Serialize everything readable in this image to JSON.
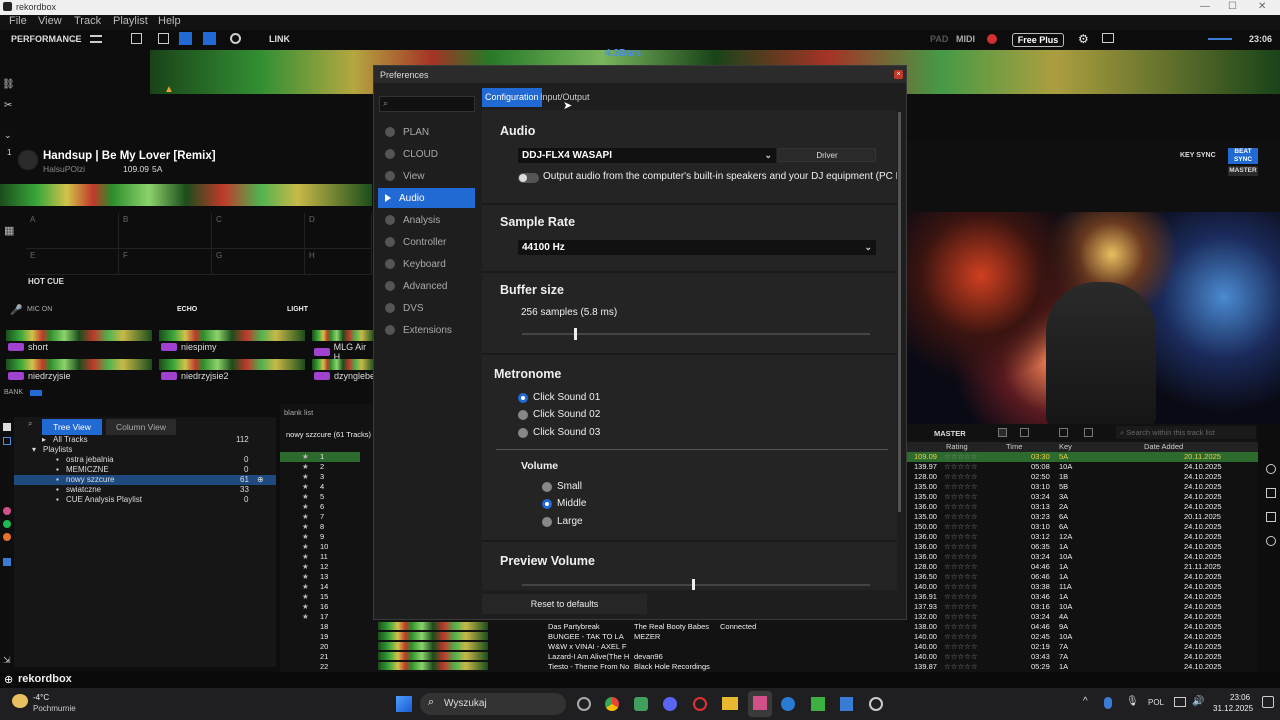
{
  "window": {
    "title": "rekordbox"
  },
  "menu": [
    "File",
    "View",
    "Track",
    "Playlist",
    "Help"
  ],
  "toolbar": {
    "mode": "PERFORMANCE",
    "link": "LINK",
    "pad": "PAD",
    "midi": "MIDI",
    "free_plus": "Free Plus",
    "clock": "23:06",
    "bars": "4.3Bars"
  },
  "deck": {
    "title": "Handsup | Be My Lover [Remix]",
    "artist": "HalsuPOlzi",
    "bpm": "109.09",
    "key": "5A",
    "hot_cue": "HOT CUE",
    "pads": [
      "A",
      "B",
      "C",
      "D",
      "E",
      "F",
      "G",
      "H"
    ],
    "key_sync": "KEY SYNC",
    "beat_sync": "BEAT SYNC",
    "master": "MASTER"
  },
  "fx": {
    "mic": "MIC ON",
    "echo": "ECHO",
    "light": "LIGHT"
  },
  "samplers": [
    {
      "name": "short"
    },
    {
      "name": "niespimy"
    },
    {
      "name": "MLG Air H"
    },
    {
      "name": "niedrzyjsie"
    },
    {
      "name": "niedrzyjsie2"
    },
    {
      "name": "dzynglebe"
    }
  ],
  "bank": "BANK",
  "browser": {
    "tree_view": "Tree View",
    "column_view": "Column View",
    "all_tracks": "All Tracks",
    "all_count": "112",
    "playlists": "Playlists",
    "items": [
      {
        "name": "ostra jebalnia",
        "count": "0"
      },
      {
        "name": "MEMICZNE",
        "count": "0"
      },
      {
        "name": "nowy szzcure",
        "count": "61"
      },
      {
        "name": "swiatczne",
        "count": "33"
      },
      {
        "name": "CUE Analysis Playlist",
        "count": "0"
      }
    ],
    "blank_list": "blank list",
    "playlist_header": "nowy szzcure (61 Tracks)"
  },
  "tracks": [
    {
      "n": "18",
      "title": "Das Partybreak",
      "artist": "The Real Booty Babes",
      "extra": "Connected"
    },
    {
      "n": "19",
      "title": "BUNGEE - TAK TO LA",
      "artist": "MEZER",
      "extra": ""
    },
    {
      "n": "20",
      "title": "W&W x VINAI - AXEL F",
      "artist": "",
      "extra": ""
    },
    {
      "n": "21",
      "title": "Lazard-I Am Alive(The H",
      "artist": "devan96",
      "extra": ""
    },
    {
      "n": "22",
      "title": "Tiesto - Theme From No",
      "artist": "Black Hole Recordings",
      "extra": ""
    }
  ],
  "tracknums": [
    "1",
    "2",
    "3",
    "4",
    "5",
    "6",
    "7",
    "8",
    "9",
    "10",
    "11",
    "12",
    "13",
    "14",
    "15",
    "16",
    "17"
  ],
  "right": {
    "master": "MASTER",
    "search_placeholder": "Search within this track list",
    "headers": [
      "Rating",
      "Time",
      "Key",
      "Date Added"
    ],
    "rows": [
      {
        "bpm": "109.09",
        "time": "03:30",
        "key": "5A",
        "date": "20.11.2025"
      },
      {
        "bpm": "139.97",
        "time": "05:08",
        "key": "10A",
        "date": "24.10.2025"
      },
      {
        "bpm": "128.00",
        "time": "02:50",
        "key": "1B",
        "date": "24.10.2025"
      },
      {
        "bpm": "135.00",
        "time": "03:10",
        "key": "5B",
        "date": "24.10.2025"
      },
      {
        "bpm": "135.00",
        "time": "03:24",
        "key": "3A",
        "date": "24.10.2025"
      },
      {
        "bpm": "136.00",
        "time": "03:13",
        "key": "2A",
        "date": "24.10.2025"
      },
      {
        "bpm": "135.00",
        "time": "03:23",
        "key": "6A",
        "date": "20.11.2025"
      },
      {
        "bpm": "150.00",
        "time": "03:10",
        "key": "6A",
        "date": "24.10.2025"
      },
      {
        "bpm": "136.00",
        "time": "03:12",
        "key": "12A",
        "date": "24.10.2025"
      },
      {
        "bpm": "136.00",
        "time": "06:35",
        "key": "1A",
        "date": "24.10.2025"
      },
      {
        "bpm": "136.00",
        "time": "03:24",
        "key": "10A",
        "date": "24.10.2025"
      },
      {
        "bpm": "128.00",
        "time": "04:46",
        "key": "1A",
        "date": "21.11.2025"
      },
      {
        "bpm": "136.50",
        "time": "06:46",
        "key": "1A",
        "date": "24.10.2025"
      },
      {
        "bpm": "140.00",
        "time": "03:38",
        "key": "11A",
        "date": "24.10.2025"
      },
      {
        "bpm": "136.91",
        "time": "03:46",
        "key": "1A",
        "date": "24.10.2025"
      },
      {
        "bpm": "137.93",
        "time": "03:16",
        "key": "10A",
        "date": "24.10.2025"
      },
      {
        "bpm": "132.00",
        "time": "03:24",
        "key": "4A",
        "date": "24.10.2025"
      },
      {
        "bpm": "138.00",
        "time": "04:46",
        "key": "9A",
        "date": "24.10.2025"
      },
      {
        "bpm": "140.00",
        "time": "02:45",
        "key": "10A",
        "date": "24.10.2025"
      },
      {
        "bpm": "140.00",
        "time": "02:19",
        "key": "7A",
        "date": "24.10.2025"
      },
      {
        "bpm": "140.00",
        "time": "03:43",
        "key": "7A",
        "date": "24.10.2025"
      },
      {
        "bpm": "139.87",
        "time": "05:29",
        "key": "1A",
        "date": "24.10.2025"
      }
    ]
  },
  "dialog": {
    "title": "Preferences",
    "tabs": [
      "Configuration",
      "Input/Output"
    ],
    "nav": [
      "PLAN",
      "CLOUD",
      "View",
      "Audio",
      "Analysis",
      "Controller",
      "Keyboard",
      "Advanced",
      "DVS",
      "Extensions"
    ],
    "audio": {
      "heading": "Audio",
      "device": "DDJ-FLX4 WASAPI",
      "driver": "Driver",
      "output_text": "Output audio from the computer's built-in speakers and your DJ equipment (PC MAS"
    },
    "sample_rate": {
      "heading": "Sample Rate",
      "value": "44100 Hz"
    },
    "buffer": {
      "heading": "Buffer size",
      "value": "256 samples (5.8 ms)"
    },
    "metronome": {
      "heading": "Metronome",
      "sounds": [
        "Click Sound 01",
        "Click Sound 02",
        "Click Sound 03"
      ],
      "volume_heading": "Volume",
      "volumes": [
        "Small",
        "Middle",
        "Large"
      ]
    },
    "preview": {
      "heading": "Preview Volume"
    },
    "reset": "Reset to defaults"
  },
  "taskbar": {
    "weather": "-4°C",
    "weather_desc": "Pochmurnie",
    "search": "Wyszukaj",
    "lang": "POL",
    "time": "23:06",
    "date": "31.12.2025"
  },
  "brand": "rekordbox"
}
